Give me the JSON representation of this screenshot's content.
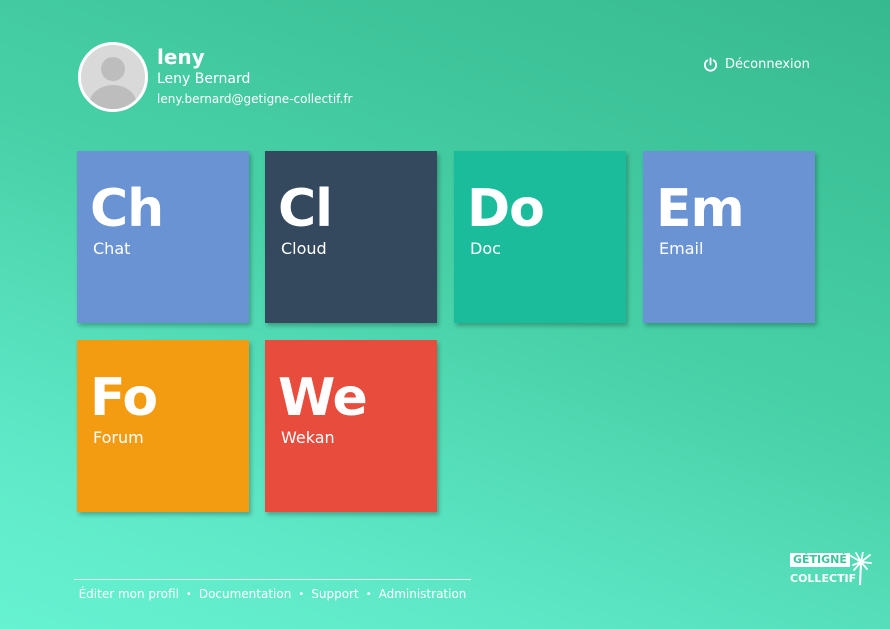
{
  "user": {
    "username": "leny",
    "fullname": "Leny Bernard",
    "email": "leny.bernard@getigne-collectif.fr"
  },
  "logout": {
    "label": "Déconnexion",
    "icon": "power-icon"
  },
  "apps": [
    {
      "abbr": "Ch",
      "label": "Chat",
      "color": "#6a93d4"
    },
    {
      "abbr": "Cl",
      "label": "Cloud",
      "color": "#34495e"
    },
    {
      "abbr": "Do",
      "label": "Doc",
      "color": "#1abc9c"
    },
    {
      "abbr": "Em",
      "label": "Email",
      "color": "#6a93d4"
    },
    {
      "abbr": "Fo",
      "label": "Forum",
      "color": "#f39c12"
    },
    {
      "abbr": "We",
      "label": "Wekan",
      "color": "#e74c3c"
    }
  ],
  "footer": {
    "links": [
      "Éditer mon profil",
      "Documentation",
      "Support",
      "Administration"
    ]
  },
  "brand": {
    "line1": "GÉTIGNÉ",
    "line2": "COLLECTIF"
  }
}
